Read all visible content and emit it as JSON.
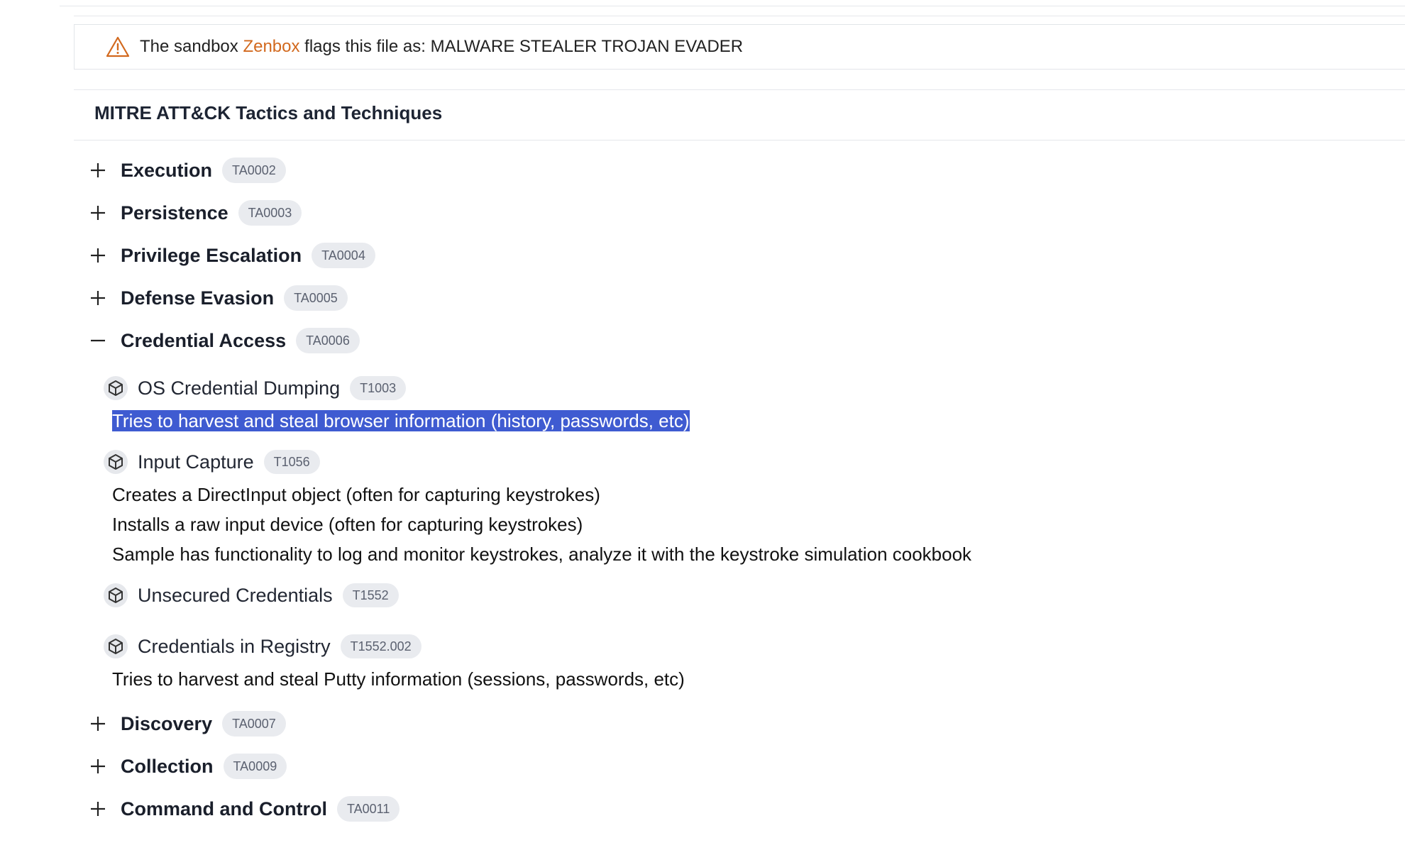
{
  "sandbox": {
    "prefix": "The sandbox ",
    "name": "Zenbox",
    "suffix": " flags this file as: MALWARE STEALER TROJAN EVADER",
    "warning_color": "#d2691e",
    "icon": "warning-triangle-icon"
  },
  "mitre": {
    "title": "MITRE ATT&CK Tactics and Techniques",
    "tactics": [
      {
        "name": "Execution",
        "id": "TA0002",
        "expanded": false
      },
      {
        "name": "Persistence",
        "id": "TA0003",
        "expanded": false
      },
      {
        "name": "Privilege Escalation",
        "id": "TA0004",
        "expanded": false
      },
      {
        "name": "Defense Evasion",
        "id": "TA0005",
        "expanded": false
      },
      {
        "name": "Credential Access",
        "id": "TA0006",
        "expanded": true,
        "techniques": [
          {
            "name": "OS Credential Dumping",
            "id": "T1003",
            "descriptions": [
              "Tries to harvest and steal browser information (history, passwords, etc)"
            ]
          },
          {
            "name": "Input Capture",
            "id": "T1056",
            "descriptions": [
              "Creates a DirectInput object (often for capturing keystrokes)",
              "Installs a raw input device (often for capturing keystrokes)",
              "Sample has functionality to log and monitor keystrokes, analyze it with the keystroke simulation cookbook"
            ]
          },
          {
            "name": "Unsecured Credentials",
            "id": "T1552",
            "descriptions": []
          },
          {
            "name": "Credentials in Registry",
            "id": "T1552.002",
            "descriptions": [
              "Tries to harvest and steal Putty information (sessions, passwords, etc)"
            ]
          }
        ]
      },
      {
        "name": "Discovery",
        "id": "TA0007",
        "expanded": false
      },
      {
        "name": "Collection",
        "id": "TA0009",
        "expanded": false
      },
      {
        "name": "Command and Control",
        "id": "TA0011",
        "expanded": false
      }
    ]
  },
  "selection_color": "#3f5bd1"
}
